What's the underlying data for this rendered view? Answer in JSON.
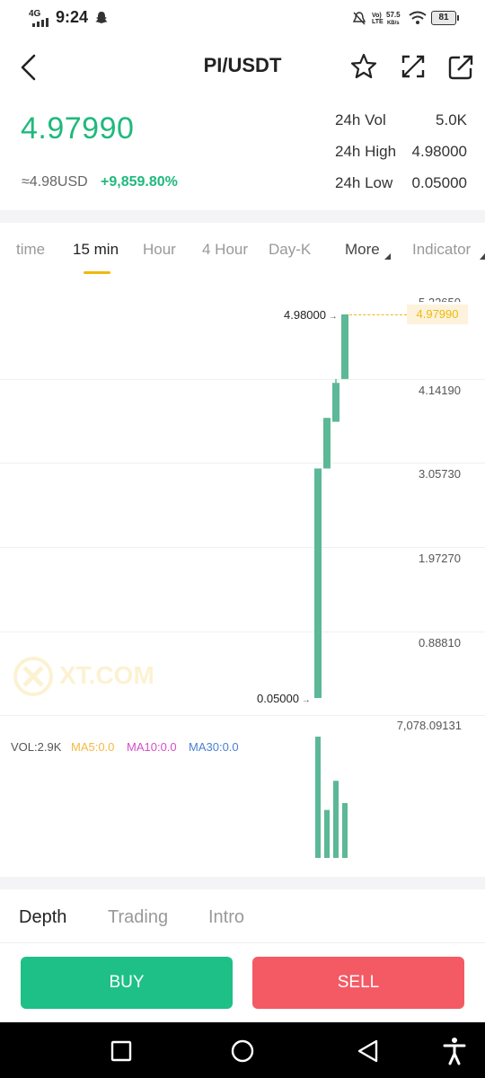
{
  "status_bar": {
    "network": "4G",
    "time": "9:24",
    "lte_label": "Vo) LTE",
    "speed_value": "57.5",
    "speed_unit": "KB/s",
    "battery": "81"
  },
  "header": {
    "title": "PI/USDT",
    "icons": [
      "back-arrow-icon",
      "star-icon",
      "fullscreen-icon",
      "share-icon"
    ]
  },
  "price": {
    "last": "4.97990",
    "usd": "≈4.98USD",
    "change": "+9,859.80%",
    "stats": [
      {
        "label": "24h Vol",
        "value": "5.0K"
      },
      {
        "label": "24h High",
        "value": "4.98000"
      },
      {
        "label": "24h Low",
        "value": "0.05000"
      }
    ]
  },
  "interval_tabs": [
    {
      "label": "time"
    },
    {
      "label": "15 min",
      "active": true
    },
    {
      "label": "Hour"
    },
    {
      "label": "4 Hour"
    },
    {
      "label": "Day-K"
    },
    {
      "label": "More"
    },
    {
      "label": "Indicator"
    }
  ],
  "chart": {
    "axis_labels": [
      "5.22650",
      "4.14190",
      "3.05730",
      "1.97270",
      "0.88810"
    ],
    "high_marker": "4.98000",
    "low_marker": "0.05000",
    "last_price_tag": "4.97990",
    "watermark": "XT.COM",
    "volume_axis_label": "7,078.09131",
    "vol_legend": {
      "vol": "VOL:2.9K",
      "ma5": "MA5:0.0",
      "ma10": "MA10:0.0",
      "ma30": "MA30:0.0"
    },
    "colors": {
      "up": "#5cb896",
      "accent": "#f0b90b",
      "ma5": "#f5b942",
      "ma10": "#d44fc6",
      "ma30": "#4a80d2"
    }
  },
  "chart_data": {
    "type": "candlestick",
    "ylim": [
      0.05,
      5.2265
    ],
    "candles": [
      {
        "open": 0.05,
        "close": 3.0,
        "low": 0.05,
        "high": 3.0
      },
      {
        "open": 3.0,
        "close": 3.65,
        "low": 3.0,
        "high": 3.65
      },
      {
        "open": 3.6,
        "close": 4.1,
        "low": 3.6,
        "high": 4.15
      },
      {
        "open": 4.15,
        "close": 4.98,
        "low": 4.15,
        "high": 4.98
      }
    ],
    "volume": [
      7078.09,
      2800,
      4500,
      3200
    ],
    "volume_max": 7078.09131
  },
  "bottom_tabs": [
    {
      "label": "Depth",
      "active": true
    },
    {
      "label": "Trading"
    },
    {
      "label": "Intro"
    }
  ],
  "actions": {
    "buy": "BUY",
    "sell": "SELL",
    "buy_color": "#1ec088",
    "sell_color": "#f45a64"
  },
  "navbar": {
    "icons": [
      "recent-apps-icon",
      "home-icon",
      "back-icon",
      "accessibility-icon"
    ]
  }
}
